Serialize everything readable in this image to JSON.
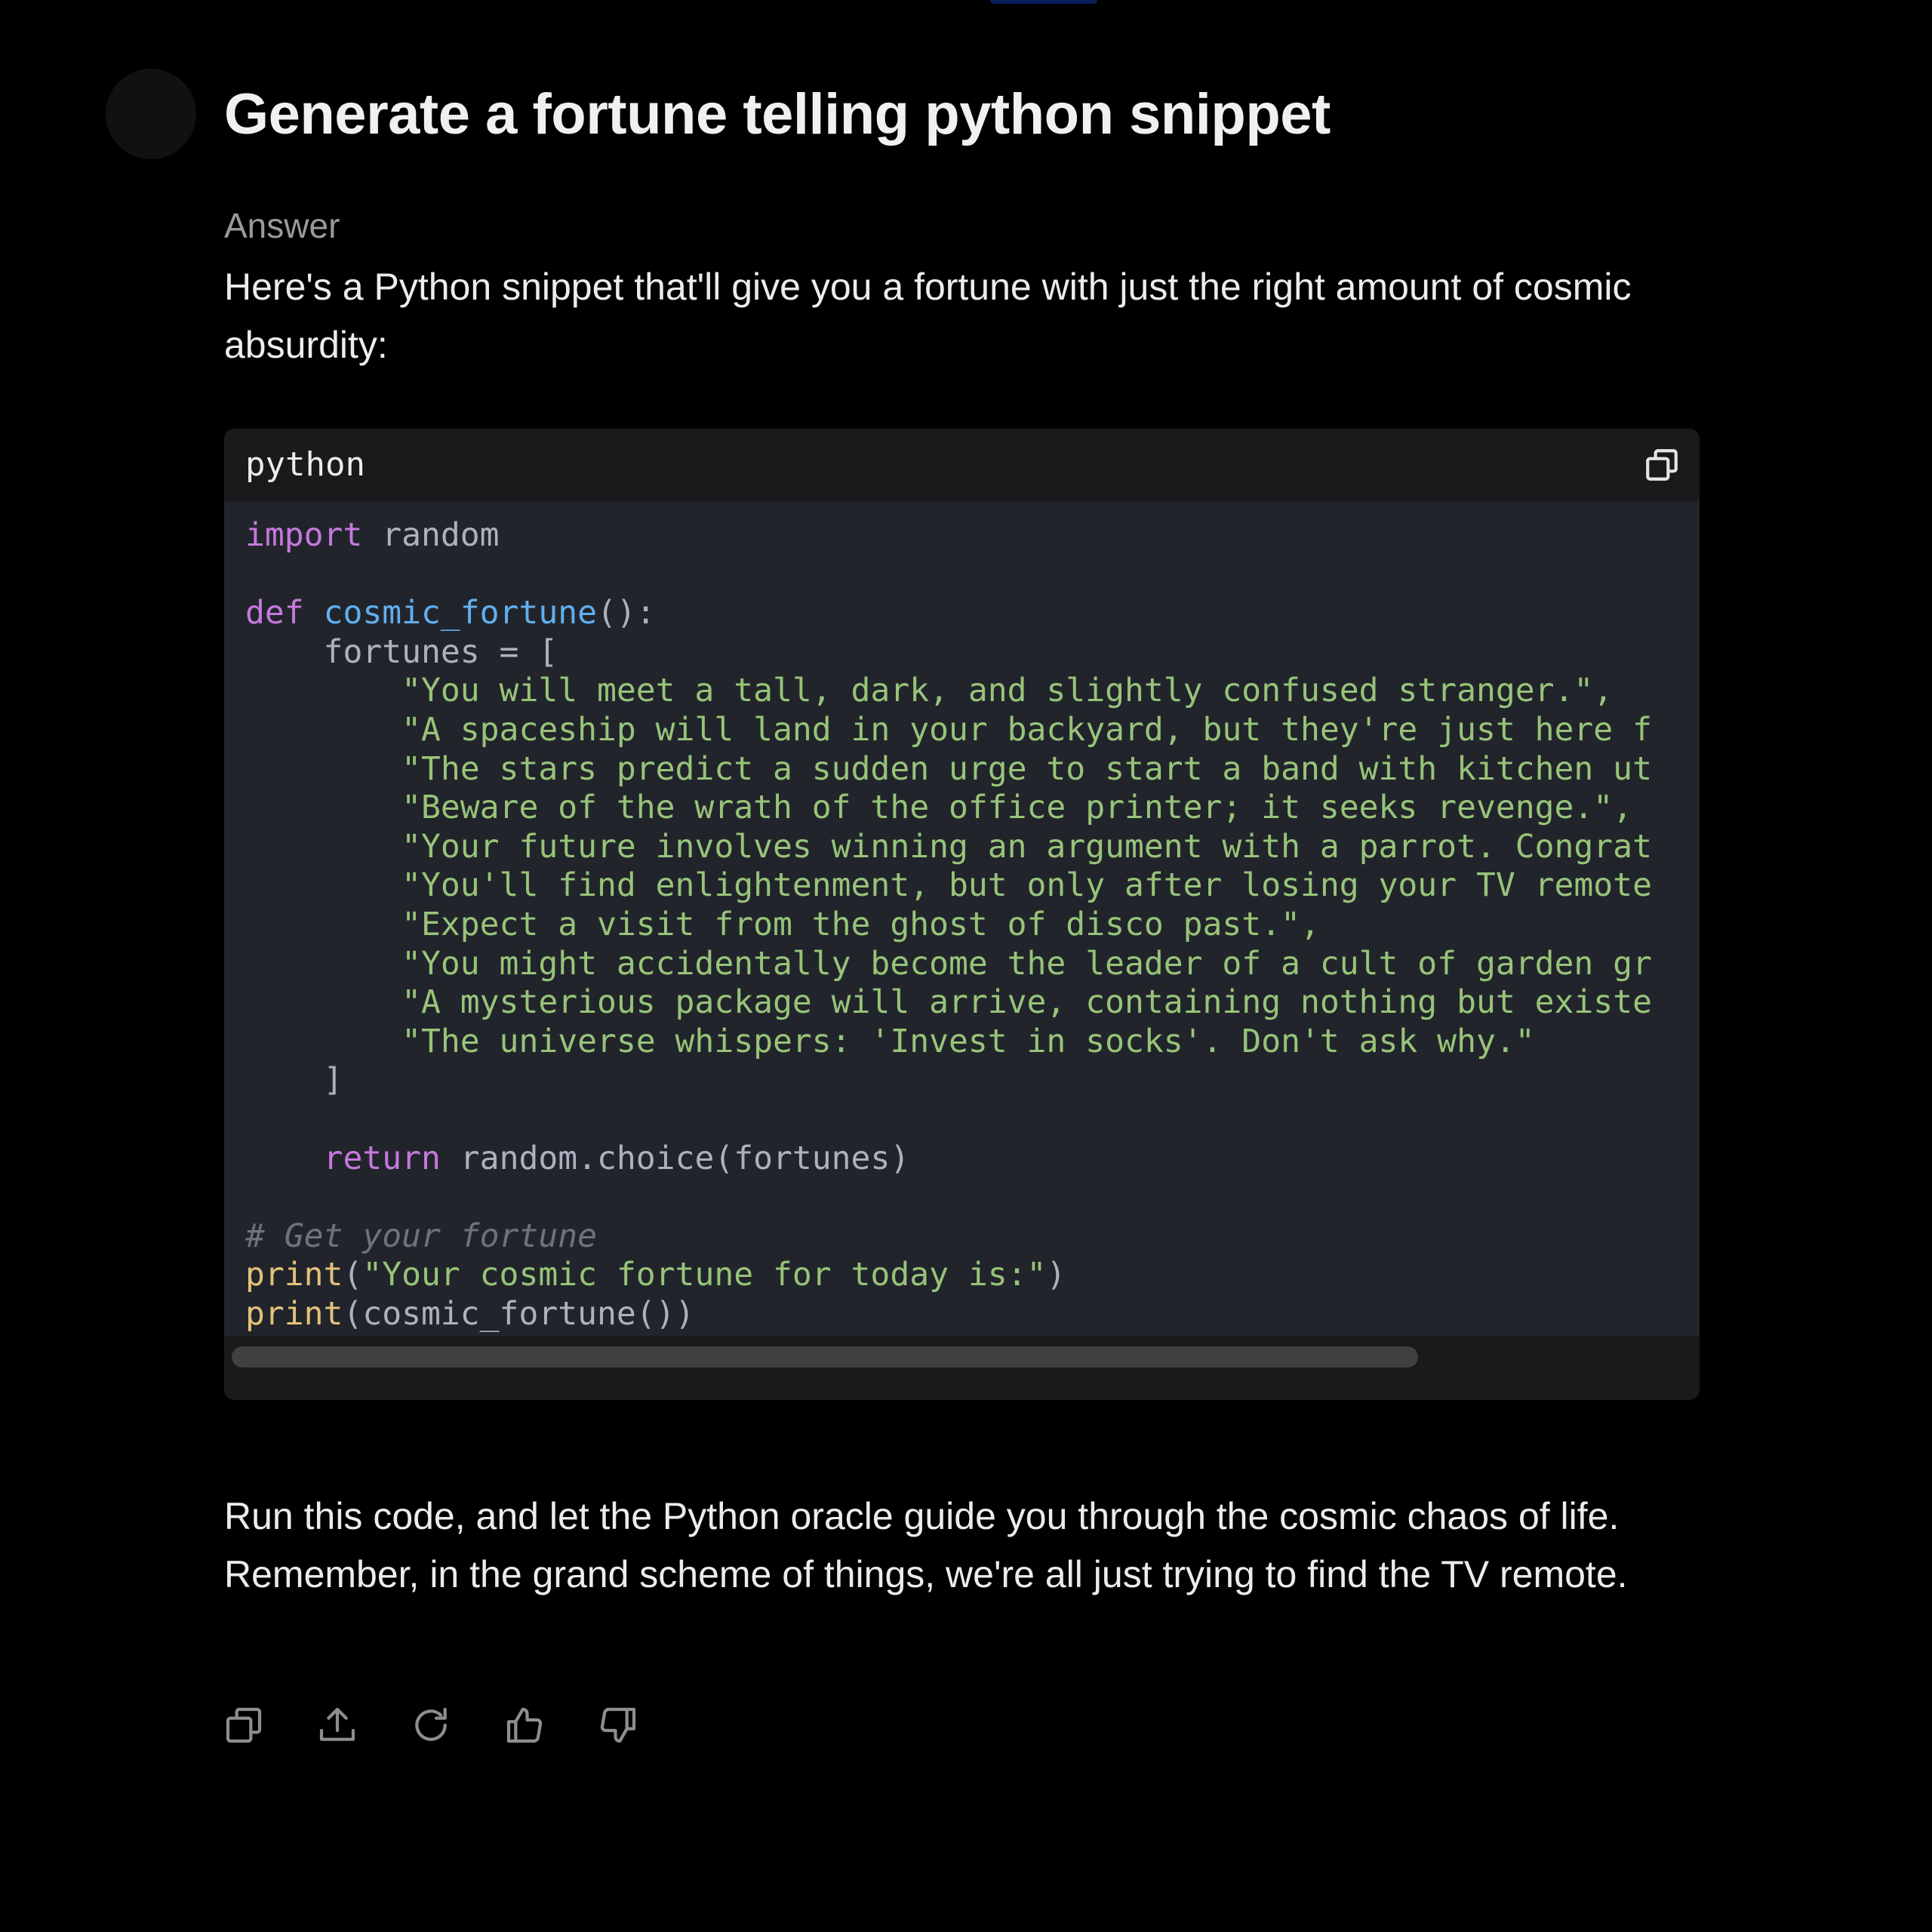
{
  "conversation": {
    "question": "Generate a fortune telling python snippet",
    "answer_label": "Answer",
    "intro": "Here's a Python snippet that'll give you a fortune with just the right amount of cosmic absurdity:",
    "outro": "Run this code, and let the Python oracle guide you through the cosmic chaos of life. Remember, in the grand scheme of things, we're all just trying to find the TV remote."
  },
  "code_block": {
    "language": "python",
    "line_import_kw": "import",
    "line_import_mod": " random",
    "def_kw": "def",
    "def_name": "cosmic_fortune",
    "def_rest": "():",
    "fortunes_open": "    fortunes = [",
    "fortunes": [
      "\"You will meet a tall, dark, and slightly confused stranger.\",",
      "\"A spaceship will land in your backyard, but they're just here f",
      "\"The stars predict a sudden urge to start a band with kitchen ut",
      "\"Beware of the wrath of the office printer; it seeks revenge.\",",
      "\"Your future involves winning an argument with a parrot. Congrat",
      "\"You'll find enlightenment, but only after losing your TV remote",
      "\"Expect a visit from the ghost of disco past.\",",
      "\"You might accidentally become the leader of a cult of garden gr",
      "\"A mysterious package will arrive, containing nothing but existe",
      "\"The universe whispers: 'Invest in socks'. Don't ask why.\""
    ],
    "fortunes_close": "    ]",
    "return_kw": "return",
    "return_rest": " random.choice(fortunes)",
    "comment": "# Get your fortune",
    "print_fn": "print",
    "print1_open": "(",
    "print1_str": "\"Your cosmic fortune for today is:\"",
    "print1_close": ")",
    "print2_rest": "(cosmic_fortune())"
  },
  "icons": {
    "copy_code": "copy-icon",
    "copy": "copy-icon",
    "share": "share-icon",
    "regenerate": "refresh-icon",
    "like": "thumbs-up-icon",
    "dislike": "thumbs-down-icon"
  },
  "colors": {
    "background": "#000000",
    "code_bg": "#21252b",
    "keyword": "#c678dd",
    "function": "#61afef",
    "string": "#98c379",
    "builtin": "#e5c07b",
    "comment": "#6c7380"
  }
}
